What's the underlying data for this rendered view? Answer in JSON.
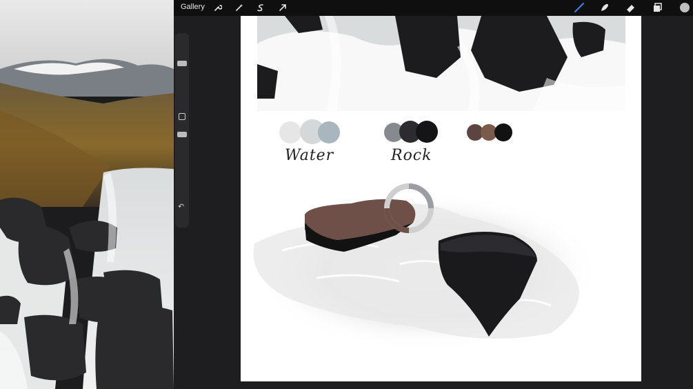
{
  "toolbar": {
    "gallery_label": "Gallery",
    "left_tools": [
      "wrench-icon",
      "magic-wand-icon",
      "selection-icon",
      "transform-arrow-icon"
    ],
    "right_tools": [
      "brush-icon",
      "smudge-icon",
      "eraser-icon",
      "layers-icon",
      "color-picker-icon"
    ],
    "active_color": "#c0c0c0",
    "active_tool_color": "#3b82f6"
  },
  "canvas": {
    "labels": {
      "water": "Water",
      "rock": "Rock"
    },
    "palettes": {
      "water": [
        "#e6e6e6",
        "#d4d8d8",
        "#a9b6bd"
      ],
      "rock": [
        "#868a8f",
        "#2c2c30",
        "#151517"
      ],
      "brown": [
        "#5b4442",
        "#7a5a4a",
        "#121212"
      ]
    }
  }
}
